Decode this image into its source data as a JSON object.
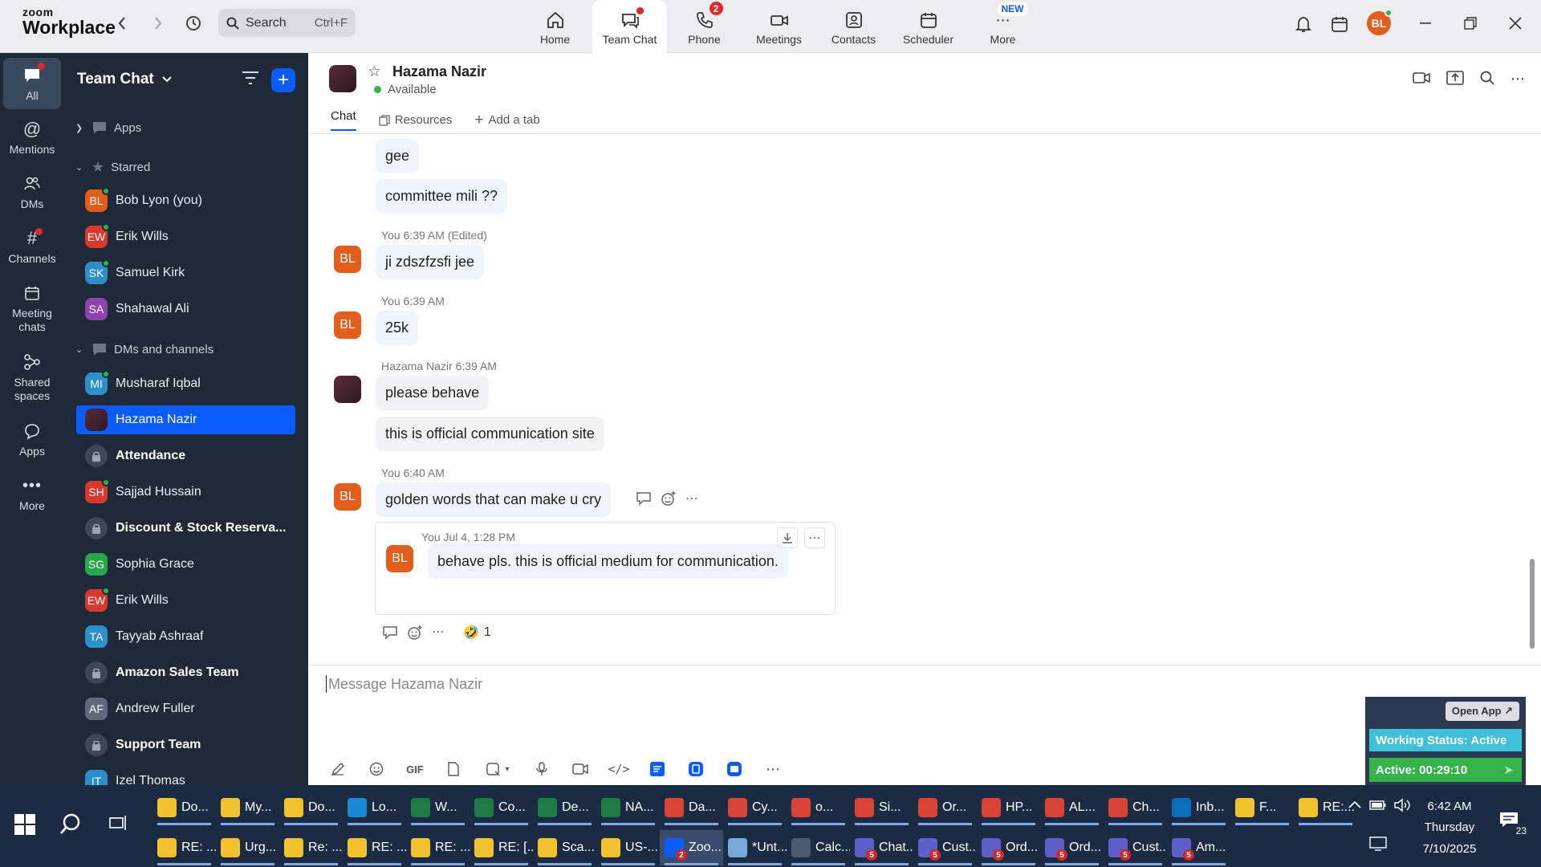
{
  "app": {
    "logo_line1": "zoom",
    "logo_line2": "Workplace",
    "search_placeholder": "Search",
    "search_shortcut": "Ctrl+F",
    "nav_tabs": [
      {
        "label": "Home",
        "icon": "home-icon"
      },
      {
        "label": "Team Chat",
        "icon": "team-chat-icon",
        "active": true
      },
      {
        "label": "Phone",
        "icon": "phone-icon",
        "badge": "2"
      },
      {
        "label": "Meetings",
        "icon": "video-camera-icon"
      },
      {
        "label": "Contacts",
        "icon": "contact-card-icon"
      },
      {
        "label": "Scheduler",
        "icon": "calendar-icon"
      },
      {
        "label": "More",
        "icon": "more-icon",
        "new_badge": "NEW"
      }
    ],
    "user_initials": "BL",
    "accent_color": "#0b5cff"
  },
  "rail": {
    "items": [
      {
        "label": "All",
        "icon": "chat-bubble-icon"
      },
      {
        "label": "Mentions",
        "icon": "at-icon"
      },
      {
        "label": "DMs",
        "icon": "people-icon"
      },
      {
        "label": "Channels",
        "icon": "hash-icon"
      },
      {
        "label": "Meeting chats",
        "icon": "calendar-icon"
      },
      {
        "label": "Shared spaces",
        "icon": "share-icon"
      },
      {
        "label": "Apps",
        "icon": "apps-bubble-icon"
      },
      {
        "label": "More",
        "icon": "ellipsis-icon"
      }
    ]
  },
  "sidebar": {
    "title": "Team Chat",
    "sections": {
      "apps": "Apps",
      "starred": "Starred",
      "dms": "DMs and channels"
    },
    "starred": [
      {
        "initials": "BL",
        "name": "Bob Lyon (you)",
        "color": "#e35d1c"
      },
      {
        "initials": "EW",
        "name": "Erik Wills",
        "color": "#d9382c"
      },
      {
        "initials": "SK",
        "name": "Samuel Kirk",
        "color": "#2c8fc9"
      },
      {
        "initials": "SA",
        "name": "Shahawal Ali",
        "color": "#8e44ad"
      }
    ],
    "dms": [
      {
        "initials": "MI",
        "name": "Musharaf Iqbal",
        "color": "#2c8fc9"
      },
      {
        "initials": "",
        "name": "Hazama Nazir",
        "color": "#4a2330",
        "selected": true
      },
      {
        "initials": "",
        "name": "Attendance",
        "channel": true
      },
      {
        "initials": "SH",
        "name": "Sajjad Hussain",
        "color": "#d9382c"
      },
      {
        "initials": "",
        "name": "Discount & Stock Reserva...",
        "channel": true
      },
      {
        "initials": "SG",
        "name": "Sophia Grace",
        "color": "#27a84a"
      },
      {
        "initials": "EW",
        "name": "Erik Wills",
        "color": "#d9382c"
      },
      {
        "initials": "TA",
        "name": "Tayyab Ashraaf",
        "color": "#2c8fc9"
      },
      {
        "initials": "",
        "name": "Amazon Sales Team",
        "channel": true
      },
      {
        "initials": "AF",
        "name": "Andrew Fuller",
        "color": "#5b6b7d"
      },
      {
        "initials": "",
        "name": "Support Team",
        "channel": true
      },
      {
        "initials": "IT",
        "name": "Izel Thomas",
        "color": "#2c8fc9"
      }
    ]
  },
  "chat": {
    "contact_name": "Hazama Nazir",
    "status": "Available",
    "tabs": [
      "Chat",
      "Resources",
      "Add a tab"
    ],
    "messages": {
      "m1": "gee",
      "m2": "committee mili ??",
      "meta3": "You 6:39 AM (Edited)",
      "m3": "ji zdszfzsfi jee",
      "meta4": "You 6:39 AM",
      "m4": "25k",
      "meta5": "Hazama Nazir 6:39 AM",
      "m5": "please behave",
      "m6": "this is official communication site",
      "meta7": "You 6:40 AM",
      "m7": "golden words that can make u cry",
      "quote_meta": "You Jul 4, 1:28 PM",
      "quote_text": "behave pls. this is official medium for communication.",
      "reaction_count": "1",
      "reaction_emoji": "🤣"
    },
    "composer_placeholder": "Message Hazama Nazir",
    "toolbar_gif": "GIF"
  },
  "widget": {
    "open_app": "Open App ↗",
    "working_status": "Working Status: Active",
    "active_time": "Active: 00:29:10"
  },
  "taskbar": {
    "row1": [
      {
        "label": "Do...",
        "color": "#f2c12e"
      },
      {
        "label": "My...",
        "color": "#f2c12e"
      },
      {
        "label": "Do...",
        "color": "#f2c12e"
      },
      {
        "label": "Lo...",
        "color": "#1b8ad6"
      },
      {
        "label": "W...",
        "color": "#1e7b43"
      },
      {
        "label": "Co...",
        "color": "#1e7b43"
      },
      {
        "label": "De...",
        "color": "#1e7b43"
      },
      {
        "label": "NA...",
        "color": "#1e7b43"
      },
      {
        "label": "Da...",
        "color": "#d94436"
      },
      {
        "label": "Cy...",
        "color": "#d94436"
      },
      {
        "label": "o...",
        "color": "#d94436"
      },
      {
        "label": "Si...",
        "color": "#d94436"
      },
      {
        "label": "Or...",
        "color": "#d94436"
      },
      {
        "label": "HP...",
        "color": "#d94436"
      },
      {
        "label": "AL...",
        "color": "#d94436"
      },
      {
        "label": "Ch...",
        "color": "#d94436"
      },
      {
        "label": "Inb...",
        "color": "#0f6cbd"
      },
      {
        "label": "F...",
        "color": "#f2c12e"
      },
      {
        "label": "RE:...",
        "color": "#f2c12e"
      }
    ],
    "row2": [
      {
        "label": "RE: ...",
        "color": "#f2c12e"
      },
      {
        "label": "Urg...",
        "color": "#f2c12e"
      },
      {
        "label": "Re: ...",
        "color": "#f2c12e"
      },
      {
        "label": "RE: ...",
        "color": "#f2c12e"
      },
      {
        "label": "RE: ...",
        "color": "#f2c12e"
      },
      {
        "label": "RE: [...",
        "color": "#f2c12e"
      },
      {
        "label": "Sca...",
        "color": "#f2c12e"
      },
      {
        "label": "US-...",
        "color": "#f2c12e"
      },
      {
        "label": "Zoo...",
        "color": "#0b5cff",
        "badge": "2",
        "active": true
      },
      {
        "label": "*Unt...",
        "color": "#7aa7d9"
      },
      {
        "label": "Calc...",
        "color": "#4a5a70"
      },
      {
        "label": "Chat...",
        "color": "#5b5fc7",
        "badge": "5"
      },
      {
        "label": "Cust...",
        "color": "#5b5fc7",
        "badge": "5"
      },
      {
        "label": "Ord...",
        "color": "#5b5fc7",
        "badge": "5"
      },
      {
        "label": "Ord...",
        "color": "#5b5fc7",
        "badge": "5"
      },
      {
        "label": "Cust...",
        "color": "#5b5fc7",
        "badge": "5"
      },
      {
        "label": "Am...",
        "color": "#5b5fc7",
        "badge": "5"
      }
    ],
    "time": "6:42 AM",
    "day": "Thursday",
    "date": "7/10/2025",
    "notification_count": "23"
  }
}
